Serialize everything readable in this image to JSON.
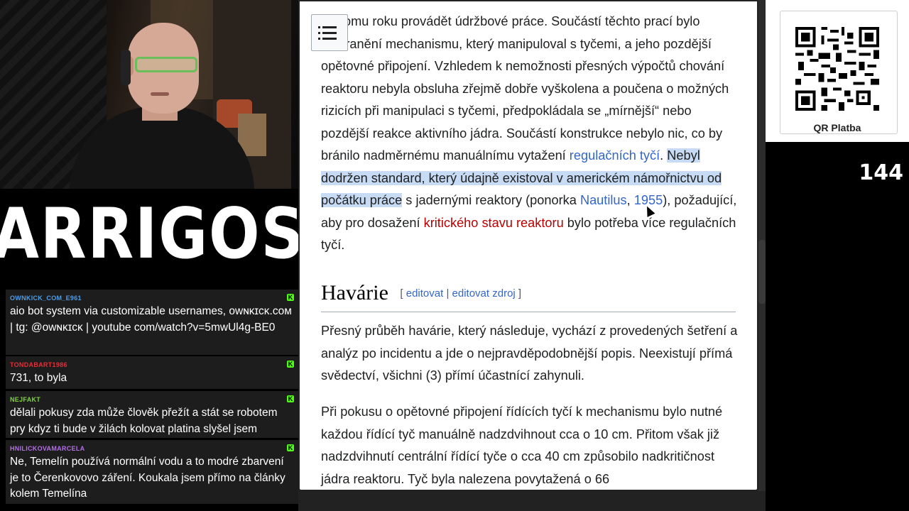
{
  "logo": {
    "text": "ARRIGOS"
  },
  "chat": {
    "messages": [
      {
        "username": "OWNKICK_COM_E961",
        "color": "#4d9de8",
        "text": "aio bot system via customizable usernames, ᴏᴡɴᴋɪᴄᴋ.ᴄᴏᴍ | tg: @ᴏᴡɴᴋɪᴄᴋ | youtube com/watch?v=5mwUl4g-BE0"
      },
      {
        "username": "TONDABART1986",
        "color": "#e0303a",
        "text": "731, to byla"
      },
      {
        "username": "NEJFAKT",
        "color": "#7cd63a",
        "text": "dělali pokusy zda může člověk přežít a stát se robotem pry kdyz ti bude v žilách kolovat platina slyšel jsem"
      },
      {
        "username": "HNILICKOVAMARCELA",
        "color": "#b46ee8",
        "text": "Ne, Temelín používá normální vodu a to modré zbarvení je to Čerenkovovo záření. Koukala jsem přímo na články kolem Temelína"
      }
    ]
  },
  "article": {
    "p1": {
      "t1": "omu roku provádět údržbové práce. Součástí těchto prací bylo odstranění mechanismu, který manipuloval s tyčemi, a jeho pozdější opětovné připojení. Vzhledem k nemožnosti přesných výpočtů chování reaktoru nebyla obsluha zřejmě dobře vyškolena a poučena o možných rizicích při manipulaci s tyčemi, předpokládala se „mírnější“ nebo pozdější reakce aktivního jádra. Součástí konstrukce nebylo nic, co by bránilo nadměrnému manuálnímu vytažení ",
      "link1": "regulačních tyčí",
      "t2": ". ",
      "highlight": "Nebyl dodržen standard, který údajně existoval v americkém námořnictvu od počátku práce",
      "t3": " s jadernými reaktory (ponorka ",
      "link2": "Nautilus",
      "t4": ", ",
      "link3": "1955",
      "t5": "), požadující, aby pro dosažení ",
      "redlink": "kritického stavu reaktoru",
      "t6": " bylo potřeba více regulačních tyčí."
    },
    "heading": {
      "title": "Havárie",
      "bracket_open": "[",
      "edit": "editovat",
      "sep": "|",
      "edit_source": "editovat zdroj",
      "bracket_close": "]"
    },
    "p2": "Přesný průběh havárie, který následuje, vychází z provedených šetření a analýz po incidentu a jde o nejpravděpodobnější popis. Neexistují přímá svědectví, všichni (3) přímí účastnící zahynuli.",
    "p3": "Při pokusu o opětovné připojení řídících tyčí k mechanismu bylo nutné každou řídící tyč manuálně nadzdvihnout cca o 10 cm. Přitom však již nadzdvihnutí centrální řídící tyče o cca 40 cm způsobilo nadkritičnost jádra reaktoru. Tyč byla nalezena povytažená o 66"
  },
  "qr": {
    "label": "QR Platba"
  },
  "counter": "144"
}
